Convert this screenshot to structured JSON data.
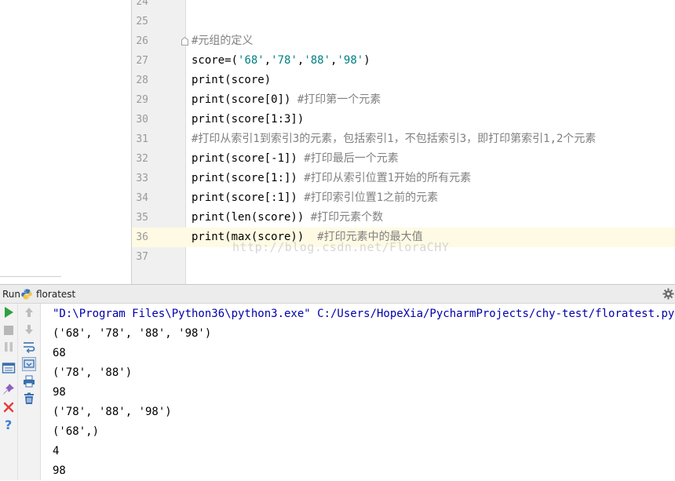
{
  "editor": {
    "lines": [
      {
        "num": "24",
        "parts": []
      },
      {
        "num": "25",
        "parts": []
      },
      {
        "num": "26",
        "parts": [
          {
            "t": "#元组的定义",
            "c": "cmt"
          }
        ],
        "fold": true
      },
      {
        "num": "27",
        "parts": [
          {
            "t": "score=(",
            "c": ""
          },
          {
            "t": "'68'",
            "c": "str"
          },
          {
            "t": ",",
            "c": ""
          },
          {
            "t": "'78'",
            "c": "str"
          },
          {
            "t": ",",
            "c": ""
          },
          {
            "t": "'88'",
            "c": "str"
          },
          {
            "t": ",",
            "c": ""
          },
          {
            "t": "'98'",
            "c": "str"
          },
          {
            "t": ")",
            "c": ""
          }
        ]
      },
      {
        "num": "28",
        "parts": [
          {
            "t": "print(score)",
            "c": ""
          }
        ]
      },
      {
        "num": "29",
        "parts": [
          {
            "t": "print(score[0]) ",
            "c": ""
          },
          {
            "t": "#打印第一个元素",
            "c": "cmt"
          }
        ]
      },
      {
        "num": "30",
        "parts": [
          {
            "t": "print(score[1:3])",
            "c": ""
          }
        ]
      },
      {
        "num": "31",
        "parts": [
          {
            "t": "#打印从索引1到索引3的元素，包括索引1，不包括索引3，即打印第索引1,2个元素",
            "c": "cmt"
          }
        ]
      },
      {
        "num": "32",
        "parts": [
          {
            "t": "print(score[-1]) ",
            "c": ""
          },
          {
            "t": "#打印最后一个元素",
            "c": "cmt"
          }
        ]
      },
      {
        "num": "33",
        "parts": [
          {
            "t": "print(score[1:]) ",
            "c": ""
          },
          {
            "t": "#打印从索引位置1开始的所有元素",
            "c": "cmt"
          }
        ]
      },
      {
        "num": "34",
        "parts": [
          {
            "t": "print(score[:1]) ",
            "c": ""
          },
          {
            "t": "#打印索引位置1之前的元素",
            "c": "cmt"
          }
        ]
      },
      {
        "num": "35",
        "parts": [
          {
            "t": "print(len(score)) ",
            "c": ""
          },
          {
            "t": "#打印元素个数",
            "c": "cmt"
          }
        ]
      },
      {
        "num": "36",
        "parts": [
          {
            "t": "print(max(score))  ",
            "c": ""
          },
          {
            "t": "#打印元素中的最大值",
            "c": "cmt"
          }
        ],
        "current": true
      },
      {
        "num": "37",
        "parts": []
      }
    ],
    "watermark": "http://blog.csdn.net/FloraCHY"
  },
  "run": {
    "label": "Run",
    "config_name": "floratest",
    "output": [
      "\"D:\\Program Files\\Python36\\python3.exe\" C:/Users/HopeXia/PycharmProjects/chy-test/floratest.py",
      "('68', '78', '88', '98')",
      "68",
      "('78', '88')",
      "98",
      "('78', '88', '98')",
      "('68',)",
      "4",
      "98"
    ]
  },
  "icons": {
    "rerun": "play-icon",
    "stop": "stop-icon",
    "pause": "pause-icon",
    "layout": "restore-layout-icon",
    "pin": "pin-icon",
    "close": "close-icon",
    "help": "help-icon",
    "up": "arrow-up-icon",
    "down": "arrow-down-icon",
    "softwrap": "soft-wrap-icon",
    "scroll_end": "scroll-to-end-icon",
    "print": "print-icon",
    "clear": "trash-icon",
    "settings": "gear-icon",
    "python": "python-icon"
  },
  "colors": {
    "string": "#008080",
    "comment": "#808080",
    "current_line": "#fffae3",
    "run_green": "#2ea040",
    "close_red": "#e33c3c"
  }
}
